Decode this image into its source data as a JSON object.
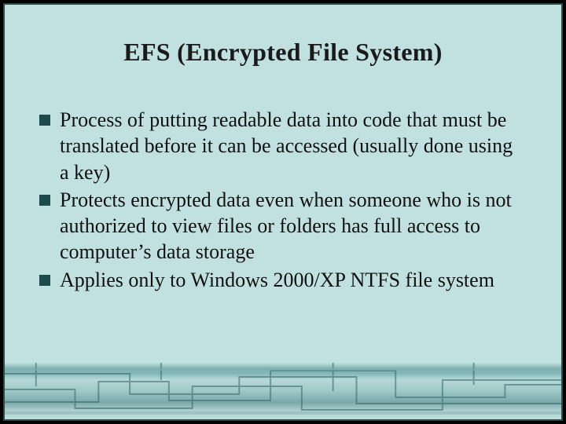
{
  "slide": {
    "title": "EFS (Encrypted File System)",
    "bullets": [
      {
        "text": "Process of putting readable data into code that must be translated before it can be accessed (usually done using a key)"
      },
      {
        "text": "Protects encrypted data even when someone who is not authorized to view files or folders has full access to computer’s data storage"
      },
      {
        "text": "Applies only to Windows 2000/XP NTFS file system"
      }
    ]
  }
}
